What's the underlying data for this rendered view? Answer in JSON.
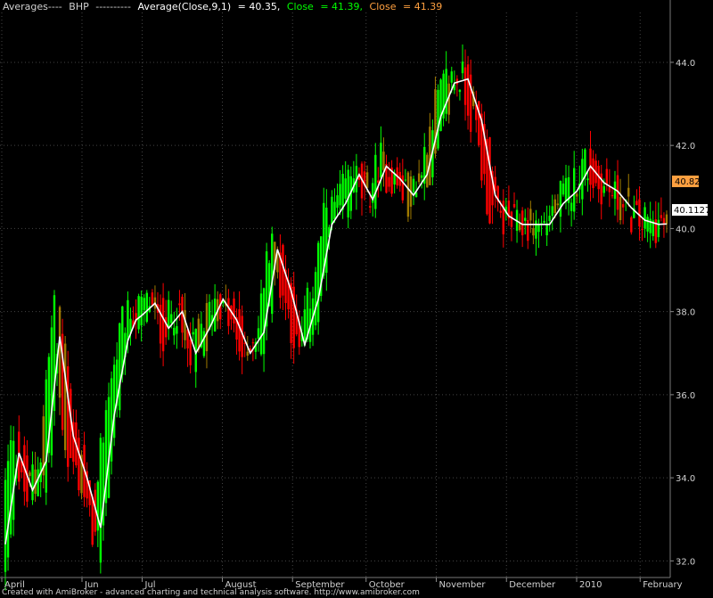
{
  "header": {
    "prefix": "Averages----",
    "symbol": "BHP",
    "dashes": "----------",
    "avg_label": "Average(Close,9,1)",
    "avg_value": "= 40.35,",
    "close_label_1": "Close",
    "close_value_1": "= 41.39,",
    "close_label_2": "Close",
    "close_value_2": "= 41.39"
  },
  "footer": "Created with AmiBroker - advanced charting and technical analysis software. http://www.amibroker.com",
  "price_tags": {
    "close": "40.82",
    "average": "40.1127"
  },
  "colors": {
    "background": "#000000",
    "up_bar": "#00ff00",
    "down_bar": "#ff0000",
    "neutral_bar": "#a07a00",
    "average_line": "#ffffff",
    "close_tag": "#ffa040",
    "grid": "#444444"
  },
  "chart_data": {
    "type": "line",
    "ylim": [
      31.6,
      45.2
    ],
    "y_ticks": [
      32.0,
      34.0,
      36.0,
      38.0,
      40.0,
      42.0,
      44.0
    ],
    "y_tick_labels": [
      "32.0",
      "34.0",
      "36.0",
      "38.0",
      "40.0",
      "42.0",
      "44.0"
    ],
    "x_labels": [
      "April",
      "Jun",
      "Jul",
      "August",
      "September",
      "October",
      "November",
      "December",
      "2010",
      "February"
    ],
    "grid": true,
    "series": [
      {
        "name": "Average(Close,9,1)",
        "x": [
          0,
          5,
          10,
          15,
          20,
          25,
          30,
          35,
          40,
          45,
          48,
          50,
          55,
          60,
          65,
          70,
          75,
          80,
          85,
          90,
          95,
          100,
          105,
          110,
          115,
          120,
          125,
          130,
          135,
          140,
          145,
          150,
          155,
          160,
          165,
          170,
          175,
          180,
          185,
          190,
          195,
          200,
          202,
          205,
          210,
          215,
          220,
          225,
          230,
          235,
          240,
          243
        ],
        "values": [
          32.4,
          34.6,
          33.7,
          34.4,
          37.4,
          35.0,
          34.0,
          32.8,
          35.5,
          37.3,
          37.8,
          37.9,
          38.2,
          37.6,
          38.0,
          37.0,
          37.6,
          38.3,
          37.8,
          37.0,
          37.5,
          39.5,
          38.5,
          37.2,
          38.3,
          40.1,
          40.6,
          41.3,
          40.7,
          41.5,
          41.2,
          40.8,
          41.3,
          42.7,
          43.5,
          43.6,
          42.6,
          40.8,
          40.3,
          40.1,
          40.1,
          40.1,
          40.3,
          40.6,
          40.9,
          41.5,
          41.1,
          40.9,
          40.5,
          40.2,
          40.1,
          40.11
        ]
      }
    ]
  }
}
